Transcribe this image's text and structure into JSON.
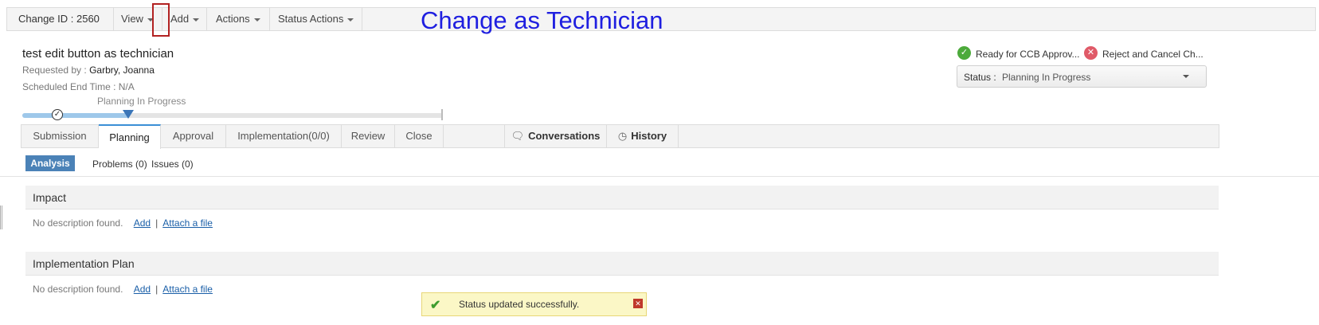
{
  "toolbar": {
    "change_id": "Change ID : 2560",
    "menus": [
      "View",
      "Add",
      "Actions",
      "Status Actions"
    ]
  },
  "overlay_caption": "Change as Technician",
  "header": {
    "title": "test edit button as technician",
    "requested_by_label": "Requested by :",
    "requested_by_value": "Garbry, Joanna",
    "scheduled_end_label": "Scheduled End Time :",
    "scheduled_end_value": "N/A"
  },
  "progress": {
    "current_stage": "Planning In Progress"
  },
  "actions": {
    "approve_label": "Ready for CCB Approv...",
    "reject_label": "Reject and Cancel Ch...",
    "status_label": "Status :",
    "status_value": "Planning In Progress"
  },
  "tabs": [
    "Submission",
    "Planning",
    "Approval",
    "Implementation(0/0)",
    "Review",
    "Close"
  ],
  "active_tab": "Planning",
  "right_tabs": [
    "Conversations",
    "History"
  ],
  "subtabs": {
    "active": "Analysis",
    "problems": "Problems (0)",
    "issues": "Issues (0)"
  },
  "sections": [
    {
      "title": "Impact",
      "empty_text": "No description found.",
      "add_link": "Add",
      "attach_link": "Attach a file",
      "separator": "|"
    },
    {
      "title": "Implementation Plan",
      "empty_text": "No description found.",
      "add_link": "Add",
      "attach_link": "Attach a file",
      "separator": "|"
    }
  ],
  "toast": {
    "message": "Status updated successfully."
  },
  "colors": {
    "accent": "#3b8fd6",
    "annotation": "#b22222",
    "caption": "#1f1fe0"
  }
}
